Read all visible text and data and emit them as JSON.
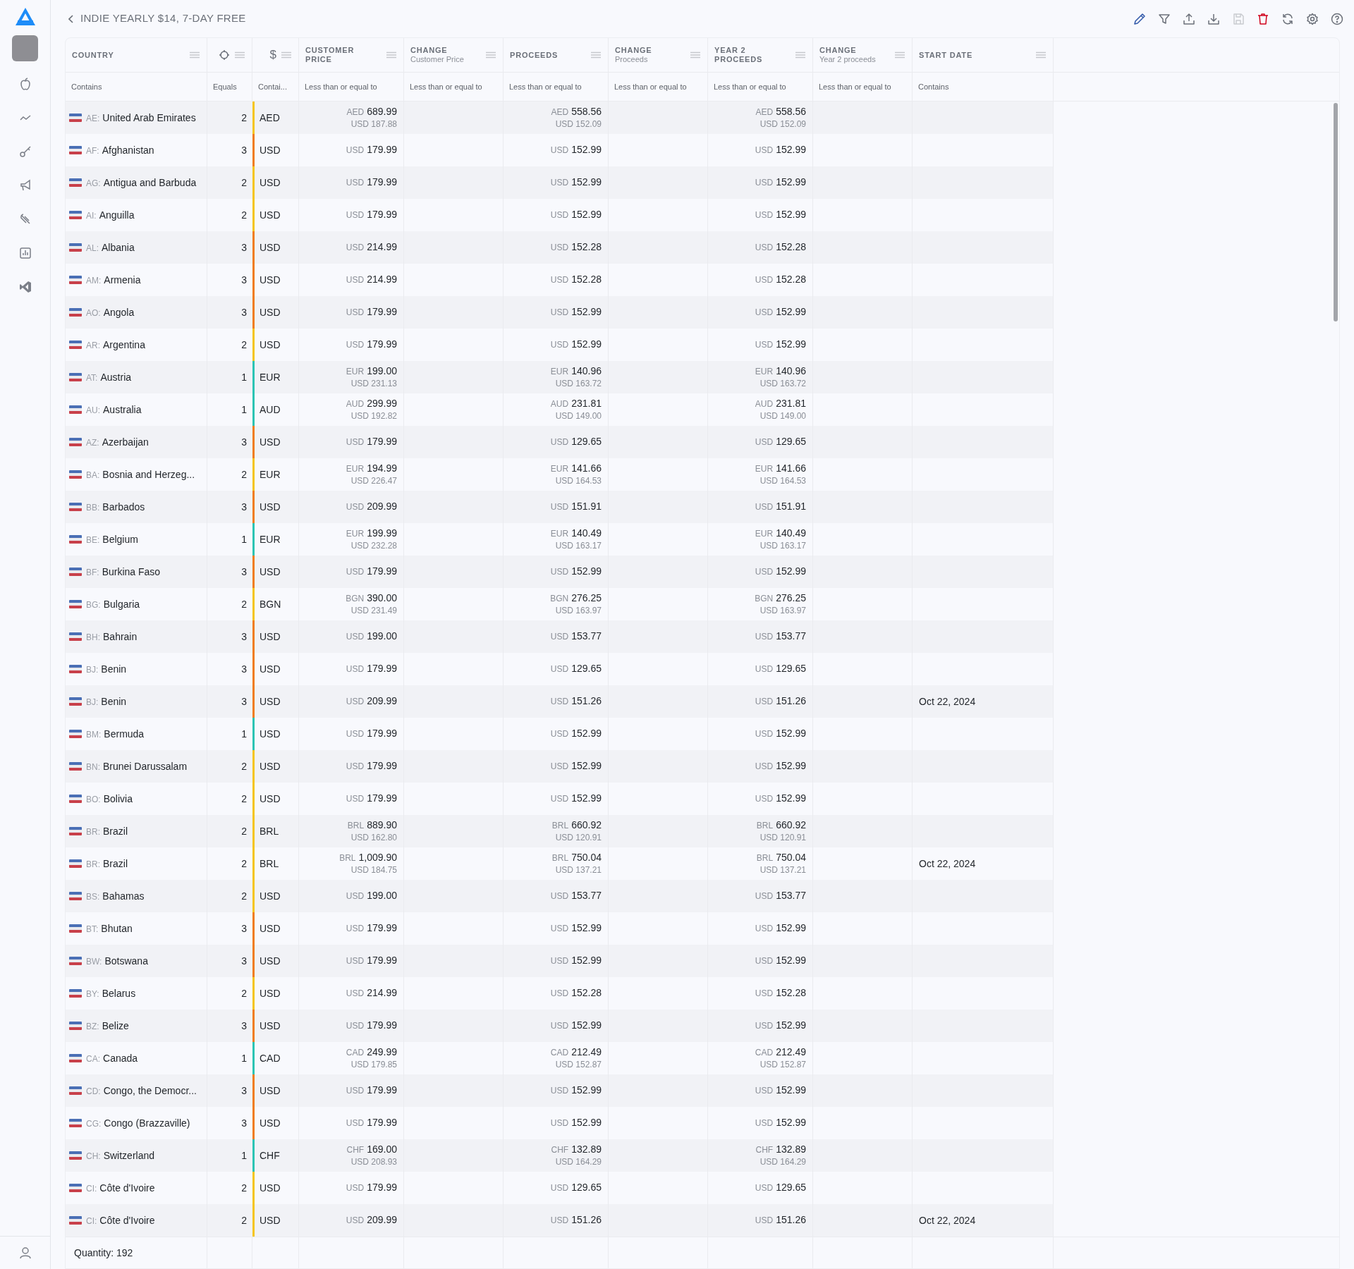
{
  "title": "INDIE YEARLY $14, 7-DAY FREE",
  "toolbar": [
    {
      "kind": "edit",
      "disabled": false
    },
    {
      "kind": "filter",
      "disabled": false
    },
    {
      "kind": "upload",
      "disabled": false
    },
    {
      "kind": "download",
      "disabled": false
    },
    {
      "kind": "save",
      "disabled": true
    },
    {
      "kind": "delete",
      "disabled": false
    },
    {
      "kind": "refresh",
      "disabled": false
    },
    {
      "kind": "settings",
      "disabled": false
    },
    {
      "kind": "help",
      "disabled": false
    }
  ],
  "columns": [
    {
      "kind": "label",
      "label": "COUNTRY"
    },
    {
      "kind": "icon"
    },
    {
      "kind": "symbol",
      "label": "$"
    },
    {
      "kind": "label",
      "label": "CUSTOMER PRICE"
    },
    {
      "kind": "label",
      "label": "CHANGE",
      "subtitle": "Customer Price"
    },
    {
      "kind": "label",
      "label": "PROCEEDS"
    },
    {
      "kind": "label",
      "label": "CHANGE",
      "subtitle": "Proceeds"
    },
    {
      "kind": "label",
      "label": "YEAR 2 PROCEEDS"
    },
    {
      "kind": "label",
      "label": "CHANGE",
      "subtitle": "Year 2 proceeds"
    },
    {
      "kind": "label",
      "label": "START DATE"
    }
  ],
  "filters": [
    {
      "placeholder": "Contains"
    },
    {
      "placeholder": "Equals"
    },
    {
      "placeholder": "Contai..."
    },
    {
      "placeholder": "Less than or equal to"
    },
    {
      "placeholder": "Less than or equal to"
    },
    {
      "placeholder": "Less than or equal to"
    },
    {
      "placeholder": "Less than or equal to"
    },
    {
      "placeholder": "Less than or equal to"
    },
    {
      "placeholder": "Less than or equal to"
    },
    {
      "placeholder": "Contains"
    }
  ],
  "rows": [
    {
      "code": "AE:",
      "country": "United Arab Emirates",
      "tier": "2",
      "color": "#f5c518",
      "currency": "AED",
      "customer_price": {
        "currency": "AED",
        "amount": "689.99",
        "converted": "USD 187.88"
      },
      "proceeds": {
        "currency": "AED",
        "amount": "558.56",
        "converted": "USD 152.09"
      },
      "year2_proceeds": {
        "currency": "AED",
        "amount": "558.56",
        "converted": "USD 152.09"
      }
    },
    {
      "code": "AF:",
      "country": "Afghanistan",
      "tier": "3",
      "color": "#f07d1a",
      "currency": "USD",
      "customer_price": {
        "currency": "USD",
        "amount": "179.99"
      },
      "proceeds": {
        "currency": "USD",
        "amount": "152.99"
      },
      "year2_proceeds": {
        "currency": "USD",
        "amount": "152.99"
      }
    },
    {
      "code": "AG:",
      "country": "Antigua and Barbuda",
      "tier": "2",
      "color": "#f5c518",
      "currency": "USD",
      "customer_price": {
        "currency": "USD",
        "amount": "179.99"
      },
      "proceeds": {
        "currency": "USD",
        "amount": "152.99"
      },
      "year2_proceeds": {
        "currency": "USD",
        "amount": "152.99"
      }
    },
    {
      "code": "AI:",
      "country": "Anguilla",
      "tier": "2",
      "color": "#f5c518",
      "currency": "USD",
      "customer_price": {
        "currency": "USD",
        "amount": "179.99"
      },
      "proceeds": {
        "currency": "USD",
        "amount": "152.99"
      },
      "year2_proceeds": {
        "currency": "USD",
        "amount": "152.99"
      }
    },
    {
      "code": "AL:",
      "country": "Albania",
      "tier": "3",
      "color": "#f07d1a",
      "currency": "USD",
      "customer_price": {
        "currency": "USD",
        "amount": "214.99"
      },
      "proceeds": {
        "currency": "USD",
        "amount": "152.28"
      },
      "year2_proceeds": {
        "currency": "USD",
        "amount": "152.28"
      }
    },
    {
      "code": "AM:",
      "country": "Armenia",
      "tier": "3",
      "color": "#f07d1a",
      "currency": "USD",
      "customer_price": {
        "currency": "USD",
        "amount": "214.99"
      },
      "proceeds": {
        "currency": "USD",
        "amount": "152.28"
      },
      "year2_proceeds": {
        "currency": "USD",
        "amount": "152.28"
      }
    },
    {
      "code": "AO:",
      "country": "Angola",
      "tier": "3",
      "color": "#f07d1a",
      "currency": "USD",
      "customer_price": {
        "currency": "USD",
        "amount": "179.99"
      },
      "proceeds": {
        "currency": "USD",
        "amount": "152.99"
      },
      "year2_proceeds": {
        "currency": "USD",
        "amount": "152.99"
      }
    },
    {
      "code": "AR:",
      "country": "Argentina",
      "tier": "2",
      "color": "#f5c518",
      "currency": "USD",
      "customer_price": {
        "currency": "USD",
        "amount": "179.99"
      },
      "proceeds": {
        "currency": "USD",
        "amount": "152.99"
      },
      "year2_proceeds": {
        "currency": "USD",
        "amount": "152.99"
      }
    },
    {
      "code": "AT:",
      "country": "Austria",
      "tier": "1",
      "color": "#2cc4b4",
      "currency": "EUR",
      "customer_price": {
        "currency": "EUR",
        "amount": "199.00",
        "converted": "USD 231.13"
      },
      "proceeds": {
        "currency": "EUR",
        "amount": "140.96",
        "converted": "USD 163.72"
      },
      "year2_proceeds": {
        "currency": "EUR",
        "amount": "140.96",
        "converted": "USD 163.72"
      }
    },
    {
      "code": "AU:",
      "country": "Australia",
      "tier": "1",
      "color": "#2cc4b4",
      "currency": "AUD",
      "customer_price": {
        "currency": "AUD",
        "amount": "299.99",
        "converted": "USD 192.82"
      },
      "proceeds": {
        "currency": "AUD",
        "amount": "231.81",
        "converted": "USD 149.00"
      },
      "year2_proceeds": {
        "currency": "AUD",
        "amount": "231.81",
        "converted": "USD 149.00"
      }
    },
    {
      "code": "AZ:",
      "country": "Azerbaijan",
      "tier": "3",
      "color": "#f07d1a",
      "currency": "USD",
      "customer_price": {
        "currency": "USD",
        "amount": "179.99"
      },
      "proceeds": {
        "currency": "USD",
        "amount": "129.65"
      },
      "year2_proceeds": {
        "currency": "USD",
        "amount": "129.65"
      }
    },
    {
      "code": "BA:",
      "country": "Bosnia and Herzeg...",
      "tier": "2",
      "color": "#f5c518",
      "currency": "EUR",
      "customer_price": {
        "currency": "EUR",
        "amount": "194.99",
        "converted": "USD 226.47"
      },
      "proceeds": {
        "currency": "EUR",
        "amount": "141.66",
        "converted": "USD 164.53"
      },
      "year2_proceeds": {
        "currency": "EUR",
        "amount": "141.66",
        "converted": "USD 164.53"
      }
    },
    {
      "code": "BB:",
      "country": "Barbados",
      "tier": "3",
      "color": "#f07d1a",
      "currency": "USD",
      "customer_price": {
        "currency": "USD",
        "amount": "209.99"
      },
      "proceeds": {
        "currency": "USD",
        "amount": "151.91"
      },
      "year2_proceeds": {
        "currency": "USD",
        "amount": "151.91"
      }
    },
    {
      "code": "BE:",
      "country": "Belgium",
      "tier": "1",
      "color": "#2cc4b4",
      "currency": "EUR",
      "customer_price": {
        "currency": "EUR",
        "amount": "199.99",
        "converted": "USD 232.28"
      },
      "proceeds": {
        "currency": "EUR",
        "amount": "140.49",
        "converted": "USD 163.17"
      },
      "year2_proceeds": {
        "currency": "EUR",
        "amount": "140.49",
        "converted": "USD 163.17"
      }
    },
    {
      "code": "BF:",
      "country": "Burkina Faso",
      "tier": "3",
      "color": "#f07d1a",
      "currency": "USD",
      "customer_price": {
        "currency": "USD",
        "amount": "179.99"
      },
      "proceeds": {
        "currency": "USD",
        "amount": "152.99"
      },
      "year2_proceeds": {
        "currency": "USD",
        "amount": "152.99"
      }
    },
    {
      "code": "BG:",
      "country": "Bulgaria",
      "tier": "2",
      "color": "#f5c518",
      "currency": "BGN",
      "customer_price": {
        "currency": "BGN",
        "amount": "390.00",
        "converted": "USD 231.49"
      },
      "proceeds": {
        "currency": "BGN",
        "amount": "276.25",
        "converted": "USD 163.97"
      },
      "year2_proceeds": {
        "currency": "BGN",
        "amount": "276.25",
        "converted": "USD 163.97"
      }
    },
    {
      "code": "BH:",
      "country": "Bahrain",
      "tier": "3",
      "color": "#f07d1a",
      "currency": "USD",
      "customer_price": {
        "currency": "USD",
        "amount": "199.00"
      },
      "proceeds": {
        "currency": "USD",
        "amount": "153.77"
      },
      "year2_proceeds": {
        "currency": "USD",
        "amount": "153.77"
      }
    },
    {
      "code": "BJ:",
      "country": "Benin",
      "tier": "3",
      "color": "#f07d1a",
      "currency": "USD",
      "customer_price": {
        "currency": "USD",
        "amount": "179.99"
      },
      "proceeds": {
        "currency": "USD",
        "amount": "129.65"
      },
      "year2_proceeds": {
        "currency": "USD",
        "amount": "129.65"
      }
    },
    {
      "code": "BJ:",
      "country": "Benin",
      "tier": "3",
      "color": "#f07d1a",
      "currency": "USD",
      "customer_price": {
        "currency": "USD",
        "amount": "209.99"
      },
      "proceeds": {
        "currency": "USD",
        "amount": "151.26"
      },
      "year2_proceeds": {
        "currency": "USD",
        "amount": "151.26"
      },
      "start_date": "Oct 22, 2024"
    },
    {
      "code": "BM:",
      "country": "Bermuda",
      "tier": "1",
      "color": "#2cc4b4",
      "currency": "USD",
      "customer_price": {
        "currency": "USD",
        "amount": "179.99"
      },
      "proceeds": {
        "currency": "USD",
        "amount": "152.99"
      },
      "year2_proceeds": {
        "currency": "USD",
        "amount": "152.99"
      }
    },
    {
      "code": "BN:",
      "country": "Brunei Darussalam",
      "tier": "2",
      "color": "#f5c518",
      "currency": "USD",
      "customer_price": {
        "currency": "USD",
        "amount": "179.99"
      },
      "proceeds": {
        "currency": "USD",
        "amount": "152.99"
      },
      "year2_proceeds": {
        "currency": "USD",
        "amount": "152.99"
      }
    },
    {
      "code": "BO:",
      "country": "Bolivia",
      "tier": "2",
      "color": "#f5c518",
      "currency": "USD",
      "customer_price": {
        "currency": "USD",
        "amount": "179.99"
      },
      "proceeds": {
        "currency": "USD",
        "amount": "152.99"
      },
      "year2_proceeds": {
        "currency": "USD",
        "amount": "152.99"
      }
    },
    {
      "code": "BR:",
      "country": "Brazil",
      "tier": "2",
      "color": "#f5c518",
      "currency": "BRL",
      "customer_price": {
        "currency": "BRL",
        "amount": "889.90",
        "converted": "USD 162.80"
      },
      "proceeds": {
        "currency": "BRL",
        "amount": "660.92",
        "converted": "USD 120.91"
      },
      "year2_proceeds": {
        "currency": "BRL",
        "amount": "660.92",
        "converted": "USD 120.91"
      }
    },
    {
      "code": "BR:",
      "country": "Brazil",
      "tier": "2",
      "color": "#f5c518",
      "currency": "BRL",
      "customer_price": {
        "currency": "BRL",
        "amount": "1,009.90",
        "converted": "USD 184.75"
      },
      "proceeds": {
        "currency": "BRL",
        "amount": "750.04",
        "converted": "USD 137.21"
      },
      "year2_proceeds": {
        "currency": "BRL",
        "amount": "750.04",
        "converted": "USD 137.21"
      },
      "start_date": "Oct 22, 2024"
    },
    {
      "code": "BS:",
      "country": "Bahamas",
      "tier": "2",
      "color": "#f5c518",
      "currency": "USD",
      "customer_price": {
        "currency": "USD",
        "amount": "199.00"
      },
      "proceeds": {
        "currency": "USD",
        "amount": "153.77"
      },
      "year2_proceeds": {
        "currency": "USD",
        "amount": "153.77"
      }
    },
    {
      "code": "BT:",
      "country": "Bhutan",
      "tier": "3",
      "color": "#f07d1a",
      "currency": "USD",
      "customer_price": {
        "currency": "USD",
        "amount": "179.99"
      },
      "proceeds": {
        "currency": "USD",
        "amount": "152.99"
      },
      "year2_proceeds": {
        "currency": "USD",
        "amount": "152.99"
      }
    },
    {
      "code": "BW:",
      "country": "Botswana",
      "tier": "3",
      "color": "#f07d1a",
      "currency": "USD",
      "customer_price": {
        "currency": "USD",
        "amount": "179.99"
      },
      "proceeds": {
        "currency": "USD",
        "amount": "152.99"
      },
      "year2_proceeds": {
        "currency": "USD",
        "amount": "152.99"
      }
    },
    {
      "code": "BY:",
      "country": "Belarus",
      "tier": "2",
      "color": "#f5c518",
      "currency": "USD",
      "customer_price": {
        "currency": "USD",
        "amount": "214.99"
      },
      "proceeds": {
        "currency": "USD",
        "amount": "152.28"
      },
      "year2_proceeds": {
        "currency": "USD",
        "amount": "152.28"
      }
    },
    {
      "code": "BZ:",
      "country": "Belize",
      "tier": "3",
      "color": "#f07d1a",
      "currency": "USD",
      "customer_price": {
        "currency": "USD",
        "amount": "179.99"
      },
      "proceeds": {
        "currency": "USD",
        "amount": "152.99"
      },
      "year2_proceeds": {
        "currency": "USD",
        "amount": "152.99"
      }
    },
    {
      "code": "CA:",
      "country": "Canada",
      "tier": "1",
      "color": "#2cc4b4",
      "currency": "CAD",
      "customer_price": {
        "currency": "CAD",
        "amount": "249.99",
        "converted": "USD 179.85"
      },
      "proceeds": {
        "currency": "CAD",
        "amount": "212.49",
        "converted": "USD 152.87"
      },
      "year2_proceeds": {
        "currency": "CAD",
        "amount": "212.49",
        "converted": "USD 152.87"
      }
    },
    {
      "code": "CD:",
      "country": "Congo, the Democr...",
      "tier": "3",
      "color": "#f07d1a",
      "currency": "USD",
      "customer_price": {
        "currency": "USD",
        "amount": "179.99"
      },
      "proceeds": {
        "currency": "USD",
        "amount": "152.99"
      },
      "year2_proceeds": {
        "currency": "USD",
        "amount": "152.99"
      }
    },
    {
      "code": "CG:",
      "country": "Congo (Brazzaville)",
      "tier": "3",
      "color": "#f07d1a",
      "currency": "USD",
      "customer_price": {
        "currency": "USD",
        "amount": "179.99"
      },
      "proceeds": {
        "currency": "USD",
        "amount": "152.99"
      },
      "year2_proceeds": {
        "currency": "USD",
        "amount": "152.99"
      }
    },
    {
      "code": "CH:",
      "country": "Switzerland",
      "tier": "1",
      "color": "#2cc4b4",
      "currency": "CHF",
      "customer_price": {
        "currency": "CHF",
        "amount": "169.00",
        "converted": "USD 208.93"
      },
      "proceeds": {
        "currency": "CHF",
        "amount": "132.89",
        "converted": "USD 164.29"
      },
      "year2_proceeds": {
        "currency": "CHF",
        "amount": "132.89",
        "converted": "USD 164.29"
      }
    },
    {
      "code": "CI:",
      "country": "Côte d'Ivoire",
      "tier": "2",
      "color": "#f5c518",
      "currency": "USD",
      "customer_price": {
        "currency": "USD",
        "amount": "179.99"
      },
      "proceeds": {
        "currency": "USD",
        "amount": "129.65"
      },
      "year2_proceeds": {
        "currency": "USD",
        "amount": "129.65"
      }
    },
    {
      "code": "CI:",
      "country": "Côte d'Ivoire",
      "tier": "2",
      "color": "#f5c518",
      "currency": "USD",
      "customer_price": {
        "currency": "USD",
        "amount": "209.99"
      },
      "proceeds": {
        "currency": "USD",
        "amount": "151.26"
      },
      "year2_proceeds": {
        "currency": "USD",
        "amount": "151.26"
      },
      "start_date": "Oct 22, 2024"
    }
  ],
  "footer": "Quantity: 192"
}
